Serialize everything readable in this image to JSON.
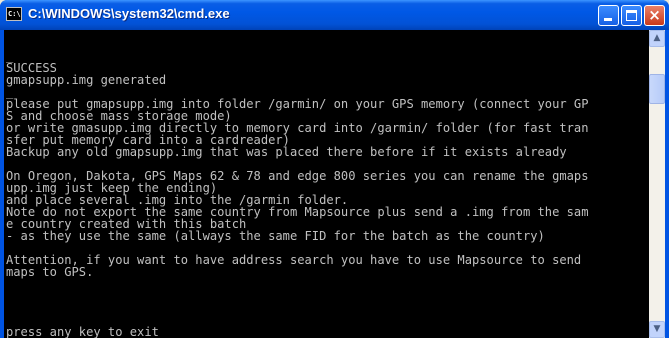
{
  "window": {
    "title": "C:\\WINDOWS\\system32\\cmd.exe",
    "icon_label": "C:\\",
    "close_glyph": "×"
  },
  "console": {
    "text": "\n_\nSUCCESS\ngmapsupp.img generated\n_\nplease put gmapsupp.img into folder /garmin/ on your GPS memory (connect your GP\nS and choose mass storage mode)\nor write gmasupp.img directly to memory card into /garmin/ folder (for fast tran\nsfer put memory card into a cardreader)\nBackup any old gmapsupp.img that was placed there before if it exists already\n\nOn Oregon, Dakota, GPS Maps 62 & 78 and edge 800 series you can rename the gmaps\nupp.img just keep the ending)\nand place several .img into the /garmin folder.\nNote do not export the same country from Mapsource plus send a .img from the sam\ne country created with this batch\n- as they use the same (allways the same FID for the batch as the country)\n\nAttention, if you want to have address search you have to use Mapsource to send\nmaps to GPS.\n\n\n\n\npress any key to exit"
  },
  "scrollbar": {
    "up_arrow": "▲",
    "down_arrow": "▼"
  },
  "icons": {
    "minimize": "minimize-icon",
    "maximize": "maximize-icon",
    "close": "close-icon",
    "app": "cmd-app-icon"
  }
}
